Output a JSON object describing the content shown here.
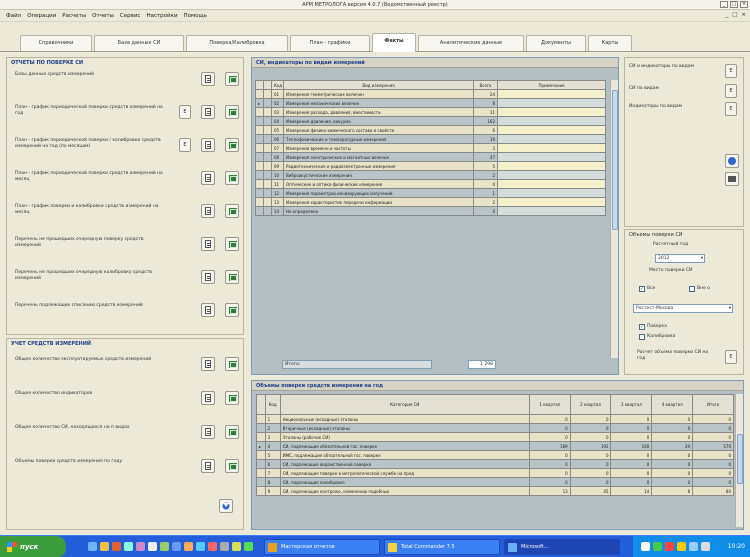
{
  "window": {
    "title": "АРМ МЕТРОЛОГА версия 4.0.7 (Ведомственный реестр)",
    "min": "_",
    "max": "□",
    "close": "×"
  },
  "menu": [
    "Файл",
    "Операции",
    "Расчеты",
    "Отчеты",
    "Сервис",
    "Настройки",
    "Помощь"
  ],
  "menu_ctrls": [
    "_",
    "□",
    "×"
  ],
  "tabs": [
    "Справочники",
    "База данных СИ",
    "Поверка/Калибровка",
    "План - графики",
    "Факты",
    "Аналитические данные",
    "Документы",
    "Карты"
  ],
  "active_tab": 4,
  "reports": {
    "title": "ОТЧЕТЫ ПО ПОВЕРКЕ СИ",
    "items": [
      {
        "label": "Базы данных средств измерений",
        "e": false
      },
      {
        "label": "План - график периодической поверки средств измерений на год",
        "e": true
      },
      {
        "label": "План - график периодической поверки / калибровки средств измерений на год (по месяцам)",
        "e": true
      },
      {
        "label": "План - график периодической поверки средств измерений на месяц",
        "e": false
      },
      {
        "label": "План - график поверки и калибровки средств измерений на месяц",
        "e": false
      },
      {
        "label": "Перечень не прошедших очередную поверку средств измерений",
        "e": false
      },
      {
        "label": "Перечень не прошедших очередную калибровку средств измерений",
        "e": false
      },
      {
        "label": "Перечень подлежащих списанию средств измерений",
        "e": false
      }
    ],
    "e_label": "E"
  },
  "accounting": {
    "title": "УЧЕТ СРЕДСТВ ИЗМЕРЕНИЙ",
    "items": [
      {
        "label": "Общее количество эксплуатируемых средств измерений"
      },
      {
        "label": "Общее количество индикаторов"
      },
      {
        "label": "Общее количество СИ, находящихся на п видах"
      },
      {
        "label": "Объемы поверки средств измерения по году"
      }
    ]
  },
  "si_grid": {
    "title": "СИ, индикаторы по видам измерений",
    "headers": [
      "Код",
      "Вид измерения",
      "Всего",
      "Примечание"
    ],
    "rows": [
      {
        "code": "01",
        "name": "Измерения геометрических величин",
        "total": "24"
      },
      {
        "code": "02",
        "name": "Измерения механических величин",
        "total": "8"
      },
      {
        "code": "03",
        "name": "Измерения расхода, давления, вместимости",
        "total": "11"
      },
      {
        "code": "04",
        "name": "Измерения давления, вакуума",
        "total": "162"
      },
      {
        "code": "05",
        "name": "Измерения физико-химического состава и свойств",
        "total": "6"
      },
      {
        "code": "06",
        "name": "Теплофизические и температурные измерения",
        "total": "19"
      },
      {
        "code": "07",
        "name": "Измерения времени и частоты",
        "total": "3"
      },
      {
        "code": "08",
        "name": "Измерения электрических и магнитных величин",
        "total": "47"
      },
      {
        "code": "09",
        "name": "Радиотехнические и радиоэлектронные измерения",
        "total": "5"
      },
      {
        "code": "10",
        "name": "Виброакустические измерения",
        "total": "2"
      },
      {
        "code": "11",
        "name": "Оптические и оптико-физические измерения",
        "total": "4"
      },
      {
        "code": "12",
        "name": "Измерения параметров ионизирующих излучений",
        "total": "1"
      },
      {
        "code": "13",
        "name": "Измерения характеристик передачи информации",
        "total": "2"
      },
      {
        "code": "14",
        "name": "Не определено",
        "total": "0"
      }
    ],
    "footer_label": "Итого:",
    "footer_total": "1 298"
  },
  "right_top": {
    "items": [
      {
        "label": "СИ и индикаторы по видам",
        "e": "E"
      },
      {
        "label": "СИ по видам",
        "e": "E"
      },
      {
        "label": "Индикаторы по видам",
        "e": "E"
      }
    ]
  },
  "volumes": {
    "title": "Объемы поверки СИ",
    "year_label": "Расчетный год",
    "year": "2012",
    "place_label": "Место поверки СИ",
    "all_label": "Все",
    "all_checked": true,
    "outside_label": "Вне о",
    "outside_checked": false,
    "org": "Ростест-Москва",
    "verification_label": "Поверка",
    "verification_checked": true,
    "calibration_label": "Калибровка",
    "calibration_checked": false,
    "calc_label": "Расчет объема поверки СИ на год",
    "e": "E"
  },
  "bottom_grid": {
    "title": "Объемы поверки средств измерения на год",
    "headers": [
      "Код",
      "Категория СИ",
      "1 квартал",
      "2 квартал",
      "3 квартал",
      "4 квартал",
      "Итого"
    ],
    "rows": [
      {
        "code": "1",
        "name": "Национальные (исходные) эталоны",
        "q": [
          "0",
          "0",
          "0",
          "0",
          "0"
        ]
      },
      {
        "code": "2",
        "name": "Вторичные (исходные) эталоны",
        "q": [
          "0",
          "0",
          "0",
          "0",
          "0"
        ]
      },
      {
        "code": "3",
        "name": "Эталоны (рабочие СИ)",
        "q": [
          "0",
          "0",
          "0",
          "0",
          "0"
        ]
      },
      {
        "code": "4",
        "name": "СИ, подлежащие обязательной гос. поверке",
        "q": [
          "189",
          "192",
          "160",
          "29",
          "570"
        ]
      },
      {
        "code": "5",
        "name": "ИМС, подлежащие обязательной гос. поверке",
        "q": [
          "0",
          "0",
          "0",
          "0",
          "0"
        ]
      },
      {
        "code": "6",
        "name": "СИ, подлежащие ведомственной поверке",
        "q": [
          "0",
          "0",
          "0",
          "0",
          "0"
        ]
      },
      {
        "code": "7",
        "name": "СИ, подлежащие поверке в метрологической службе на пред",
        "q": [
          "0",
          "0",
          "0",
          "0",
          "0"
        ]
      },
      {
        "code": "8",
        "name": "СИ, подлежащие калибровке",
        "q": [
          "0",
          "0",
          "0",
          "0",
          "0"
        ]
      },
      {
        "code": "9",
        "name": "СИ, подлежащие контролю, изменению подобных",
        "q": [
          "13",
          "45",
          "14",
          "8",
          "80"
        ]
      }
    ]
  },
  "taskbar": {
    "start": "пуск",
    "tasks": [
      "Мастерская отчетов",
      "Total Commander 7.5",
      "Microsoft..."
    ],
    "clock": "10:20"
  }
}
